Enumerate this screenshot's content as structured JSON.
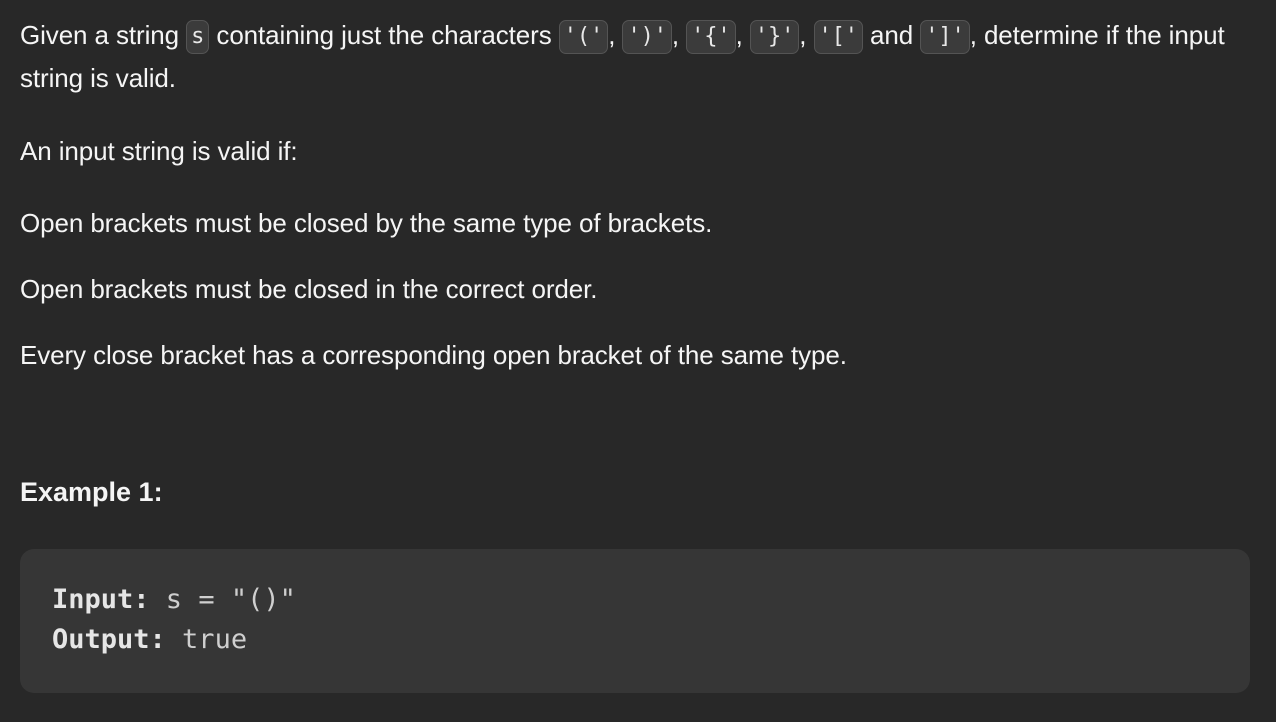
{
  "problem": {
    "intro": {
      "t1": "Given a string ",
      "c1": "s",
      "t2": " containing just the characters ",
      "c2": "'('",
      "t3": ", ",
      "c3": "')'",
      "t4": ", ",
      "c4": "'{'",
      "t5": ", ",
      "c5": "'}'",
      "t6": ", ",
      "c6": "'['",
      "t7": " and ",
      "c7": "']'",
      "t8": ", determine if the input string is valid."
    },
    "valid_heading": "An input string is valid if:",
    "rules": [
      "Open brackets must be closed by the same type of brackets.",
      "Open brackets must be closed in the correct order.",
      "Every close bracket has a corresponding open bracket of the same type."
    ]
  },
  "example": {
    "title": "Example 1:",
    "input_label": "Input:",
    "input_value": " s = \"()\"",
    "output_label": "Output:",
    "output_value": " true"
  }
}
